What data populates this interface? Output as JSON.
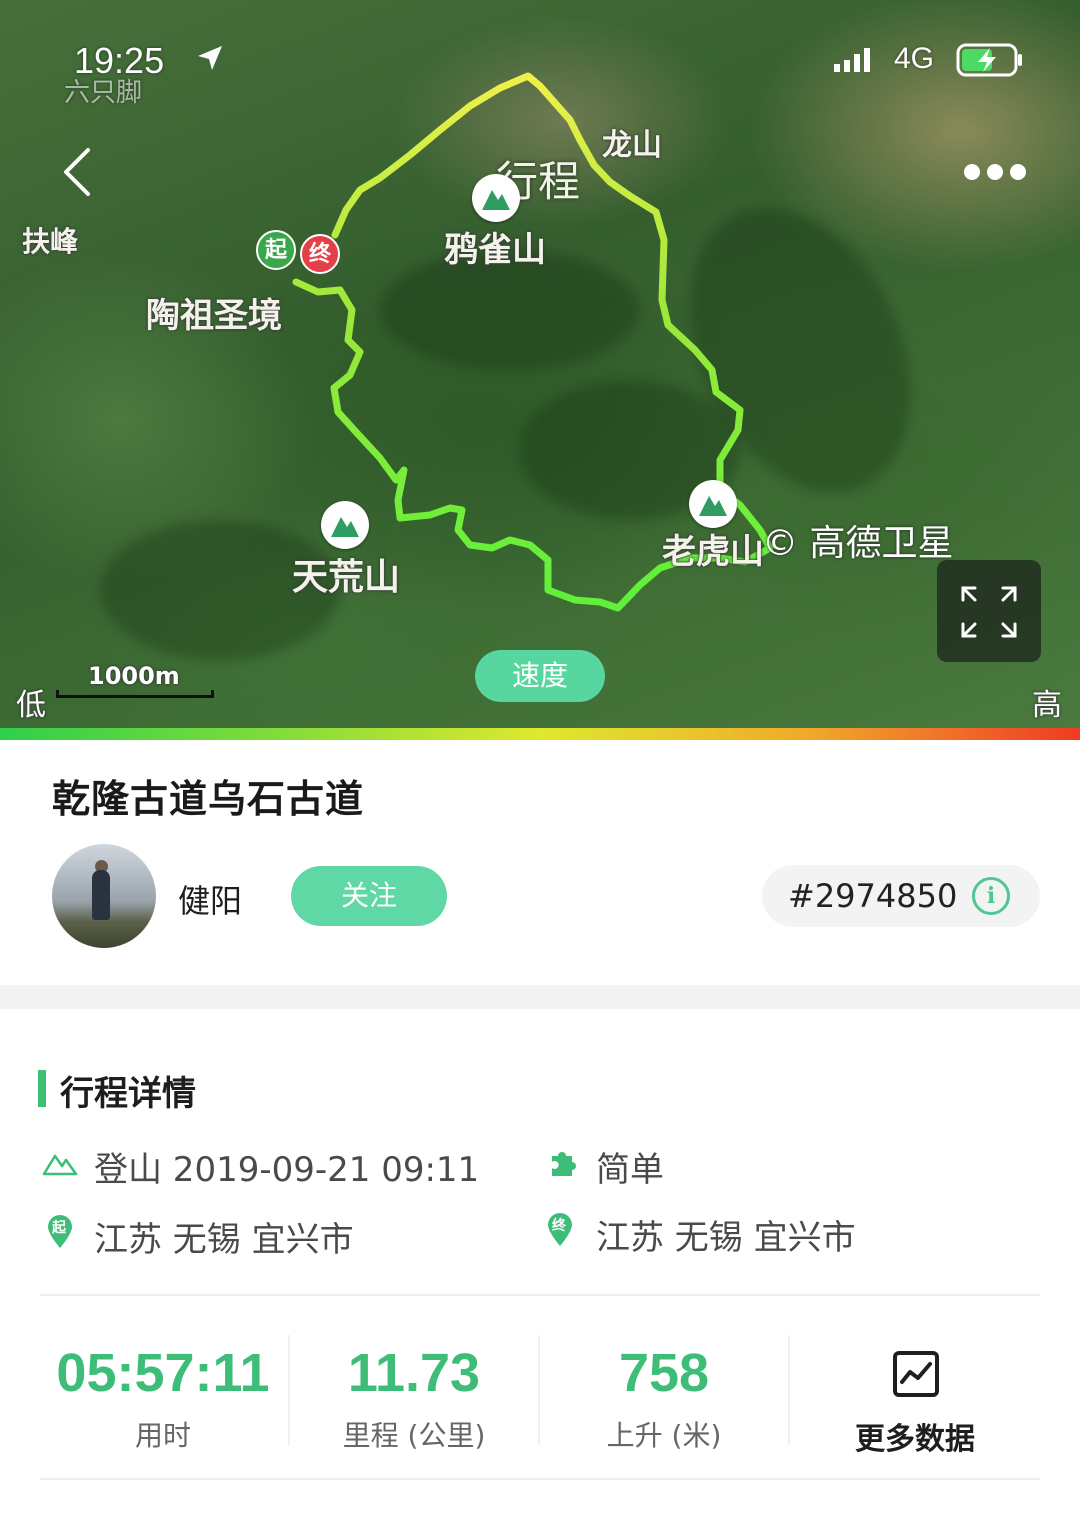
{
  "status_bar": {
    "time": "19:25",
    "network": "4G"
  },
  "watermark": "六只脚",
  "map": {
    "title": "行程",
    "speed_button": "速度",
    "scale": "1000m",
    "legend_low": "低",
    "legend_high": "高",
    "copyright": "© 高德卫星",
    "labels": {
      "fufeng": "扶峰",
      "longshan": "龙山",
      "yaque_shan": "鸦雀山",
      "taozu": "陶祖圣境",
      "tianhuang_shan": "天荒山",
      "laohu_shan": "老虎山"
    },
    "start_pin": "起",
    "end_pin": "终"
  },
  "trip": {
    "title": "乾隆古道乌石古道",
    "user": "健阳",
    "follow_label": "关注",
    "trip_id": "#2974850",
    "info_icon": "i"
  },
  "details": {
    "section_title": "行程详情",
    "activity": "登山 2019-09-21 09:11",
    "difficulty": "简单",
    "start_location": "江苏 无锡 宜兴市",
    "end_location": "江苏 无锡 宜兴市",
    "start_badge": "起",
    "end_badge": "终"
  },
  "stats": [
    {
      "value": "05:57:11",
      "label": "用时"
    },
    {
      "value": "11.73",
      "label": "里程 (公里)"
    },
    {
      "value": "758",
      "label": "上升 (米)"
    }
  ],
  "more_data_label": "更多数据",
  "colors": {
    "accent_green": "#3dbd78",
    "follow_button": "#5fd8a6",
    "start_pin": "#3aa84a",
    "end_pin": "#e5404a"
  },
  "icons": [
    "back-arrow-icon",
    "more-dots-icon",
    "location-arrow-icon",
    "signal-icon",
    "battery-icon",
    "expand-icon",
    "mountain-icon",
    "puzzle-icon",
    "location-pin-icon",
    "chart-icon",
    "info-icon"
  ]
}
